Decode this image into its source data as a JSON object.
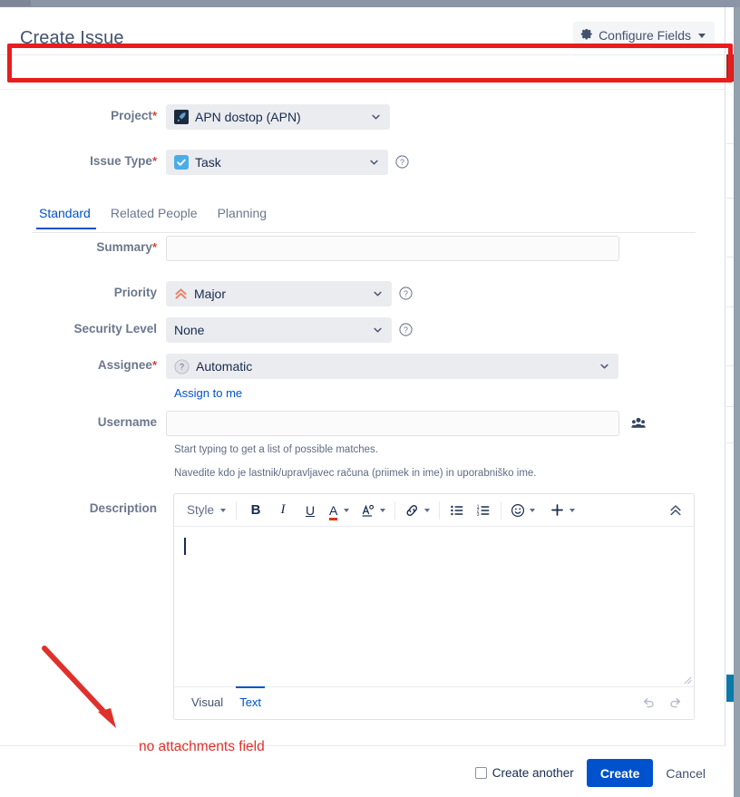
{
  "header": {
    "title": "Create Issue",
    "configure_fields_label": "Configure Fields",
    "gear_icon": "gear-icon",
    "caret_icon": "chevron-down-icon"
  },
  "fields": {
    "project": {
      "label": "Project",
      "required": "*",
      "value": "APN dostop (APN)",
      "icon": "project-avatar-icon"
    },
    "issue_type": {
      "label": "Issue Type",
      "required": "*",
      "value": "Task",
      "icon": "task-checkmark-icon",
      "help_icon": "question-circle-icon"
    },
    "summary": {
      "label": "Summary",
      "required": "*",
      "value": "",
      "placeholder": ""
    },
    "priority": {
      "label": "Priority",
      "required": "",
      "value": "Major",
      "icon": "priority-major-icon",
      "help_icon": "question-circle-icon"
    },
    "security_level": {
      "label": "Security Level",
      "required": "",
      "value": "None",
      "help_icon": "question-circle-icon"
    },
    "assignee": {
      "label": "Assignee",
      "required": "*",
      "value": "Automatic",
      "icon": "automatic-avatar-icon",
      "assign_to_me_label": "Assign to me"
    },
    "username": {
      "label": "Username",
      "required": "",
      "value": "",
      "placeholder": "",
      "picker_icon": "user-group-icon",
      "hint_1": "Start typing to get a list of possible matches.",
      "hint_2": "Navedite kdo je lastnik/upravljavec računa (priimek in ime) in uporabniško ime."
    },
    "description": {
      "label": "Description",
      "value": ""
    }
  },
  "tabs": [
    {
      "label": "Standard",
      "active": true
    },
    {
      "label": "Related People",
      "active": false
    },
    {
      "label": "Planning",
      "active": false
    }
  ],
  "editor": {
    "toolbar": [
      {
        "name": "style-dropdown",
        "label": "Style",
        "icon": "chevron-down-icon",
        "has_caret": true
      },
      {
        "name": "bold-button",
        "label": "B",
        "icon": "bold-icon",
        "has_caret": false
      },
      {
        "name": "italic-button",
        "label": "I",
        "icon": "italic-icon",
        "has_caret": false
      },
      {
        "name": "underline-button",
        "label": "U",
        "icon": "underline-icon",
        "has_caret": false
      },
      {
        "name": "text-color-button",
        "label": "A",
        "icon": "text-color-icon",
        "has_caret": true
      },
      {
        "name": "text-highlight-button",
        "label": "",
        "icon": "text-style-more-icon",
        "has_caret": true
      },
      {
        "name": "link-button",
        "label": "",
        "icon": "link-icon",
        "has_caret": true
      },
      {
        "name": "bullet-list-button",
        "label": "",
        "icon": "bullet-list-icon",
        "has_caret": false
      },
      {
        "name": "numbered-list-button",
        "label": "",
        "icon": "numbered-list-icon",
        "has_caret": false
      },
      {
        "name": "emoji-button",
        "label": "",
        "icon": "emoji-icon",
        "has_caret": true
      },
      {
        "name": "insert-more-button",
        "label": "",
        "icon": "plus-icon",
        "has_caret": true
      },
      {
        "name": "collapse-toolbar-button",
        "label": "",
        "icon": "chevrons-up-icon",
        "has_caret": false
      }
    ],
    "modes": [
      {
        "label": "Visual",
        "active": false
      },
      {
        "label": "Text",
        "active": true
      }
    ],
    "undo_icon": "undo-icon",
    "redo_icon": "redo-icon",
    "resize_icon": "resize-handle-icon"
  },
  "footer": {
    "create_another_label": "Create another",
    "create_another_checked": false,
    "create_label": "Create",
    "cancel_label": "Cancel"
  },
  "annotations": {
    "caption": "no attachments field",
    "arrow": "red-arrow-annotation",
    "rectangle": "red-rectangle-annotation",
    "color": "#e0302b"
  },
  "colors": {
    "accent": "#0052cc",
    "label": "#6b778c",
    "field_bg": "#ebecf0",
    "annotation_red": "#e81d1d"
  }
}
